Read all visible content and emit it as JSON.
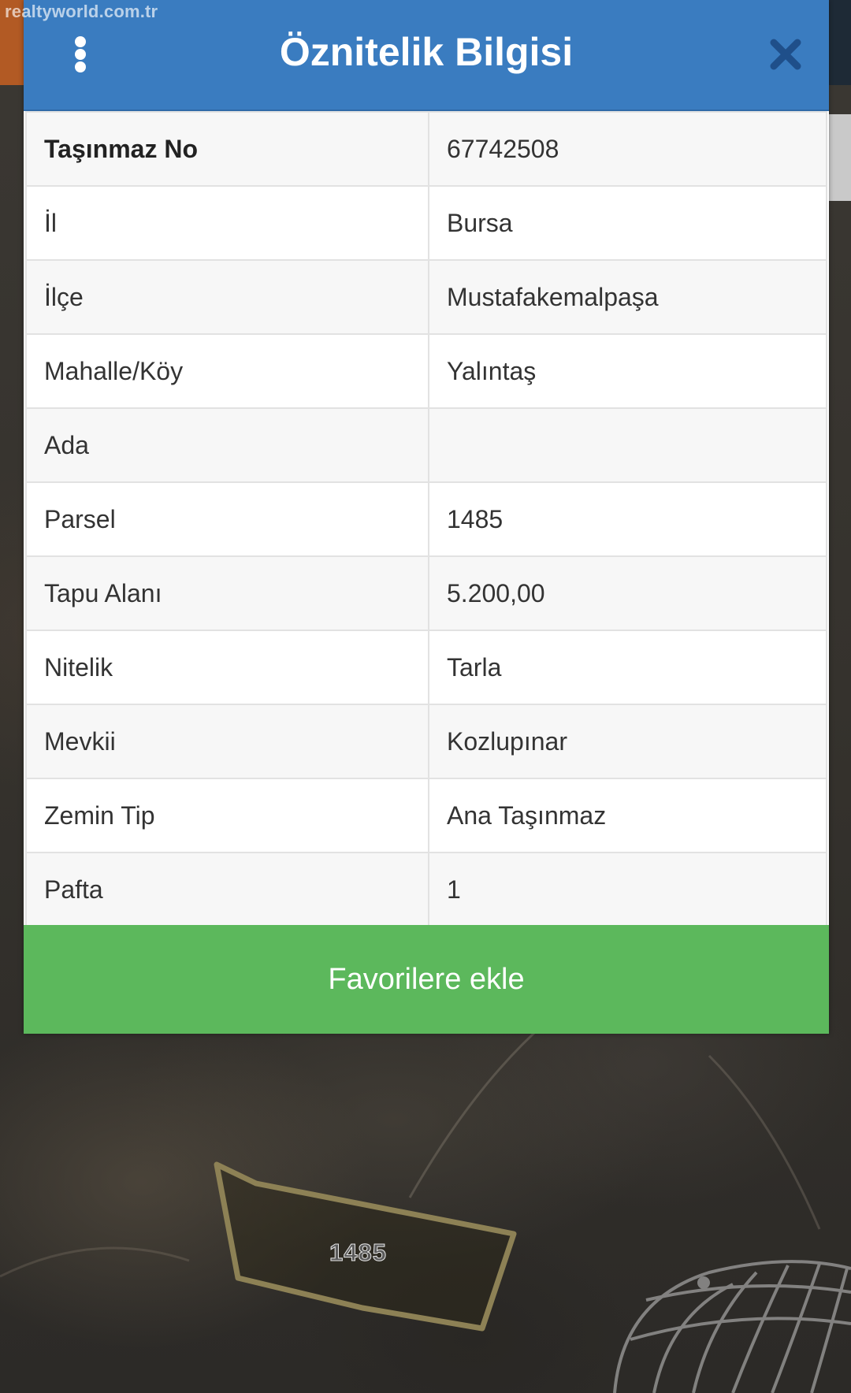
{
  "watermark": "realtyworld.com.tr",
  "dialog": {
    "title": "Öznitelik Bilgisi",
    "menu_icon": "more-vertical-icon",
    "close_icon": "close-icon",
    "header_color": "#3a7cc0"
  },
  "attributes": [
    {
      "label": "Taşınmaz No",
      "value": "67742508"
    },
    {
      "label": "İl",
      "value": "Bursa"
    },
    {
      "label": "İlçe",
      "value": "Mustafakemalpaşa"
    },
    {
      "label": "Mahalle/Köy",
      "value": "Yalıntaş"
    },
    {
      "label": "Ada",
      "value": ""
    },
    {
      "label": "Parsel",
      "value": "1485"
    },
    {
      "label": "Tapu Alanı",
      "value": "5.200,00"
    },
    {
      "label": "Nitelik",
      "value": "Tarla"
    },
    {
      "label": "Mevkii",
      "value": "Kozlupınar"
    },
    {
      "label": "Zemin Tip",
      "value": "Ana Taşınmaz"
    },
    {
      "label": "Pafta",
      "value": "1"
    }
  ],
  "actions": {
    "favorite_label": "Favorilere ekle",
    "favorite_color": "#5cb85c"
  },
  "map": {
    "parcel_label": "1485"
  }
}
